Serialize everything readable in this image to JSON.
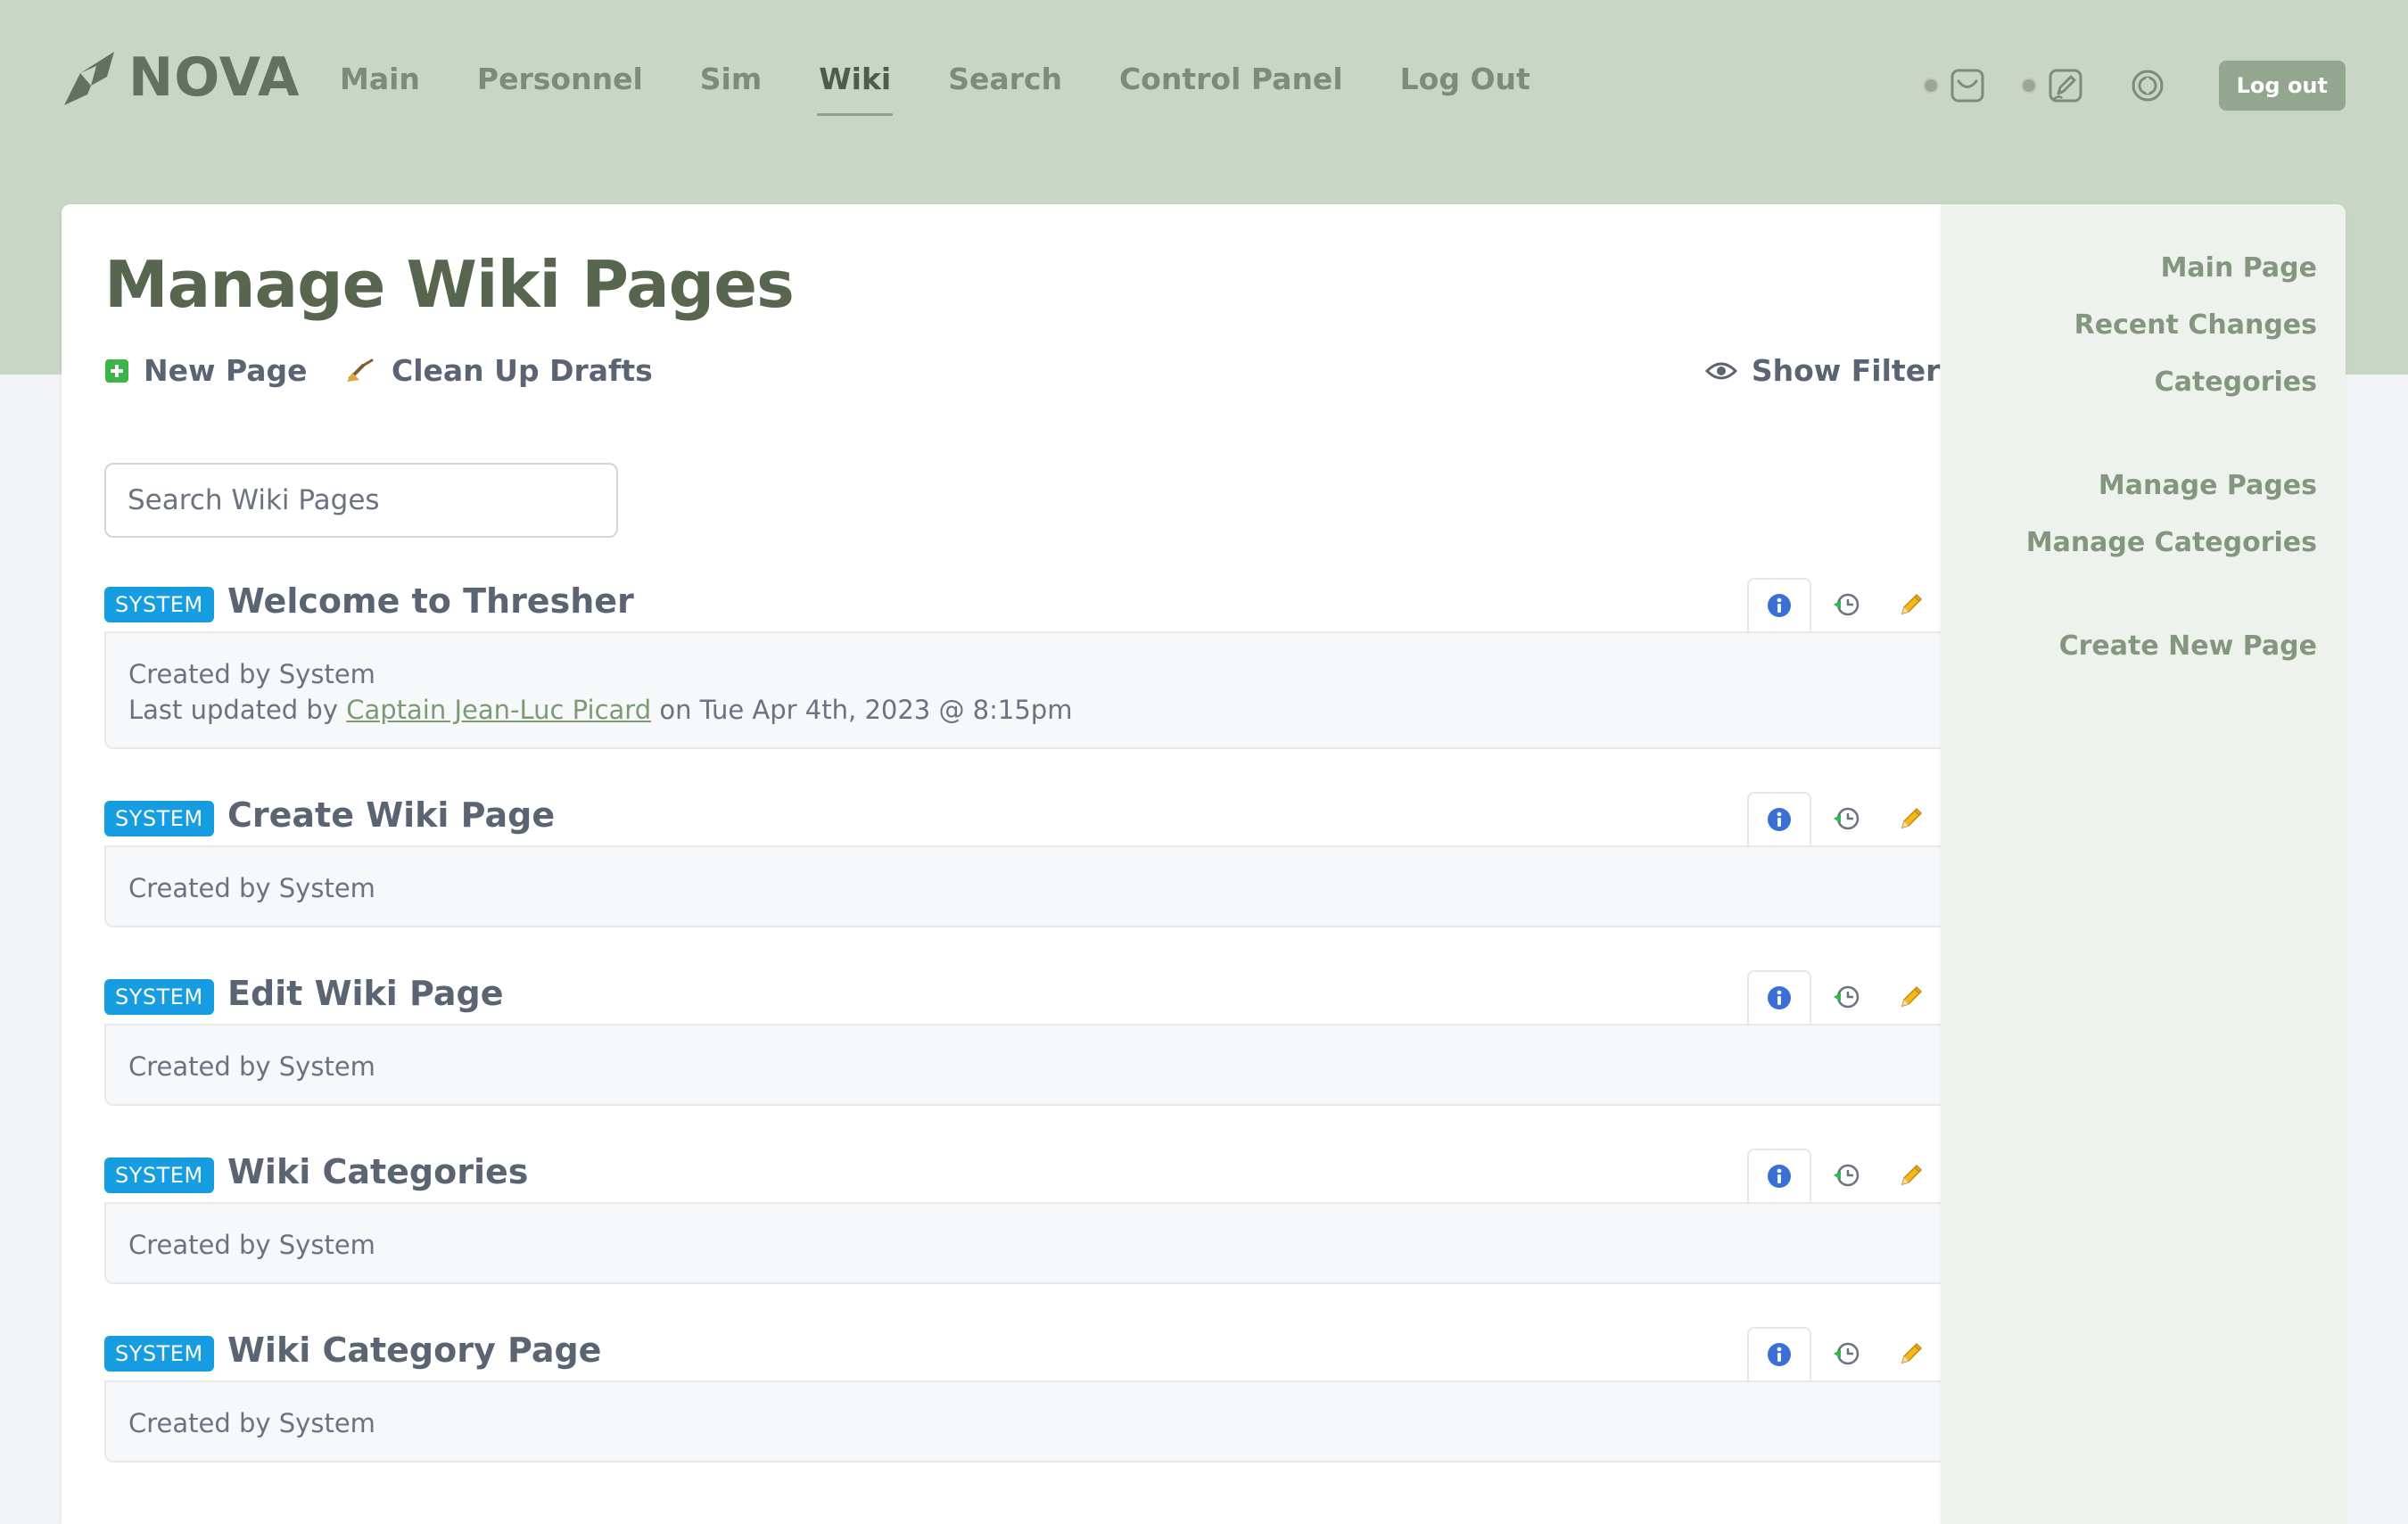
{
  "app": {
    "logo_text": "NOVA"
  },
  "nav": {
    "items": [
      {
        "label": "Main"
      },
      {
        "label": "Personnel"
      },
      {
        "label": "Sim"
      },
      {
        "label": "Wiki",
        "active": true
      },
      {
        "label": "Search"
      },
      {
        "label": "Control Panel"
      },
      {
        "label": "Log Out"
      }
    ]
  },
  "header_tools": {
    "logout_label": "Log out"
  },
  "page": {
    "title": "Manage Wiki Pages",
    "actions": {
      "new_page": "New Page",
      "clean_up": "Clean Up Drafts",
      "show_filters": "Show Filters"
    },
    "search": {
      "placeholder": "Search Wiki Pages",
      "value": ""
    }
  },
  "pages": [
    {
      "badge": "SYSTEM",
      "title": "Welcome to Thresher",
      "created": "Created by System",
      "updated_prefix": "Last updated by",
      "updated_by": "Captain Jean-Luc Picard",
      "updated_suffix": "on Tue Apr 4th, 2023 @ 8:15pm"
    },
    {
      "badge": "SYSTEM",
      "title": "Create Wiki Page",
      "created": "Created by System"
    },
    {
      "badge": "SYSTEM",
      "title": "Edit Wiki Page",
      "created": "Created by System"
    },
    {
      "badge": "SYSTEM",
      "title": "Wiki Categories",
      "created": "Created by System"
    },
    {
      "badge": "SYSTEM",
      "title": "Wiki Category Page",
      "created": "Created by System"
    }
  ],
  "sidebar": {
    "links": [
      {
        "label": "Main Page"
      },
      {
        "label": "Recent Changes"
      },
      {
        "label": "Categories"
      },
      {
        "label": "Manage Pages"
      },
      {
        "label": "Manage Categories"
      },
      {
        "label": "Create New Page"
      }
    ]
  },
  "colors": {
    "header_bg": "#c9d6c5",
    "badge": "#169ce0",
    "link_green": "#7d9a73",
    "accent": "#93a78e"
  }
}
